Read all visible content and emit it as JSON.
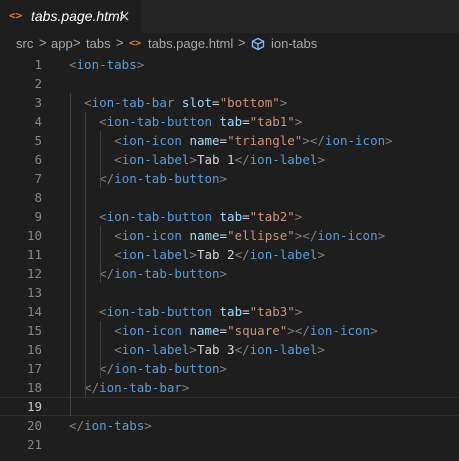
{
  "colors": {
    "background": "#1e1e1e",
    "tab_bar": "#252526",
    "file_icon": "#e37933",
    "tag": "#569cd6",
    "attribute": "#9cdcfe",
    "string": "#ce9178",
    "bracket": "#808080",
    "text": "#d4d4d4",
    "line_number": "#858585"
  },
  "tab": {
    "icon": "<>",
    "label": "tabs.page.html",
    "close": "×",
    "close_icon": "close-icon"
  },
  "breadcrumb": {
    "items": [
      "src",
      "app",
      "tabs",
      "tabs.page.html",
      "ion-tabs"
    ],
    "separator": ">",
    "file_icon": "<>",
    "symbol_icon": "cube-icon"
  },
  "editor": {
    "current_line": 19,
    "lines": [
      {
        "n": "1",
        "tokens": [
          [
            "b",
            "<"
          ],
          [
            "t",
            "ion-tabs"
          ],
          [
            "b",
            ">"
          ]
        ]
      },
      {
        "n": "2",
        "tokens": []
      },
      {
        "n": "3",
        "tokens": [
          [
            "s",
            "  "
          ],
          [
            "b",
            "<"
          ],
          [
            "t",
            "ion-tab-bar"
          ],
          [
            "s",
            " "
          ],
          [
            "a",
            "slot"
          ],
          [
            "e",
            "="
          ],
          [
            "r",
            "\"bottom\""
          ],
          [
            "b",
            ">"
          ]
        ]
      },
      {
        "n": "4",
        "tokens": [
          [
            "s",
            "    "
          ],
          [
            "b",
            "<"
          ],
          [
            "t",
            "ion-tab-button"
          ],
          [
            "s",
            " "
          ],
          [
            "a",
            "tab"
          ],
          [
            "e",
            "="
          ],
          [
            "r",
            "\"tab1\""
          ],
          [
            "b",
            ">"
          ]
        ]
      },
      {
        "n": "5",
        "tokens": [
          [
            "s",
            "      "
          ],
          [
            "b",
            "<"
          ],
          [
            "t",
            "ion-icon"
          ],
          [
            "s",
            " "
          ],
          [
            "a",
            "name"
          ],
          [
            "e",
            "="
          ],
          [
            "r",
            "\"triangle\""
          ],
          [
            "b",
            "></"
          ],
          [
            "t",
            "ion-icon"
          ],
          [
            "b",
            ">"
          ]
        ]
      },
      {
        "n": "6",
        "tokens": [
          [
            "s",
            "      "
          ],
          [
            "b",
            "<"
          ],
          [
            "t",
            "ion-label"
          ],
          [
            "b",
            ">"
          ],
          [
            "x",
            "Tab 1"
          ],
          [
            "b",
            "</"
          ],
          [
            "t",
            "ion-label"
          ],
          [
            "b",
            ">"
          ]
        ]
      },
      {
        "n": "7",
        "tokens": [
          [
            "s",
            "    "
          ],
          [
            "b",
            "</"
          ],
          [
            "t",
            "ion-tab-button"
          ],
          [
            "b",
            ">"
          ]
        ]
      },
      {
        "n": "8",
        "tokens": []
      },
      {
        "n": "9",
        "tokens": [
          [
            "s",
            "    "
          ],
          [
            "b",
            "<"
          ],
          [
            "t",
            "ion-tab-button"
          ],
          [
            "s",
            " "
          ],
          [
            "a",
            "tab"
          ],
          [
            "e",
            "="
          ],
          [
            "r",
            "\"tab2\""
          ],
          [
            "b",
            ">"
          ]
        ]
      },
      {
        "n": "10",
        "tokens": [
          [
            "s",
            "      "
          ],
          [
            "b",
            "<"
          ],
          [
            "t",
            "ion-icon"
          ],
          [
            "s",
            " "
          ],
          [
            "a",
            "name"
          ],
          [
            "e",
            "="
          ],
          [
            "r",
            "\"ellipse\""
          ],
          [
            "b",
            "></"
          ],
          [
            "t",
            "ion-icon"
          ],
          [
            "b",
            ">"
          ]
        ]
      },
      {
        "n": "11",
        "tokens": [
          [
            "s",
            "      "
          ],
          [
            "b",
            "<"
          ],
          [
            "t",
            "ion-label"
          ],
          [
            "b",
            ">"
          ],
          [
            "x",
            "Tab 2"
          ],
          [
            "b",
            "</"
          ],
          [
            "t",
            "ion-label"
          ],
          [
            "b",
            ">"
          ]
        ]
      },
      {
        "n": "12",
        "tokens": [
          [
            "s",
            "    "
          ],
          [
            "b",
            "</"
          ],
          [
            "t",
            "ion-tab-button"
          ],
          [
            "b",
            ">"
          ]
        ]
      },
      {
        "n": "13",
        "tokens": []
      },
      {
        "n": "14",
        "tokens": [
          [
            "s",
            "    "
          ],
          [
            "b",
            "<"
          ],
          [
            "t",
            "ion-tab-button"
          ],
          [
            "s",
            " "
          ],
          [
            "a",
            "tab"
          ],
          [
            "e",
            "="
          ],
          [
            "r",
            "\"tab3\""
          ],
          [
            "b",
            ">"
          ]
        ]
      },
      {
        "n": "15",
        "tokens": [
          [
            "s",
            "      "
          ],
          [
            "b",
            "<"
          ],
          [
            "t",
            "ion-icon"
          ],
          [
            "s",
            " "
          ],
          [
            "a",
            "name"
          ],
          [
            "e",
            "="
          ],
          [
            "r",
            "\"square\""
          ],
          [
            "b",
            "></"
          ],
          [
            "t",
            "ion-icon"
          ],
          [
            "b",
            ">"
          ]
        ]
      },
      {
        "n": "16",
        "tokens": [
          [
            "s",
            "      "
          ],
          [
            "b",
            "<"
          ],
          [
            "t",
            "ion-label"
          ],
          [
            "b",
            ">"
          ],
          [
            "x",
            "Tab 3"
          ],
          [
            "b",
            "</"
          ],
          [
            "t",
            "ion-label"
          ],
          [
            "b",
            ">"
          ]
        ]
      },
      {
        "n": "17",
        "tokens": [
          [
            "s",
            "    "
          ],
          [
            "b",
            "</"
          ],
          [
            "t",
            "ion-tab-button"
          ],
          [
            "b",
            ">"
          ]
        ]
      },
      {
        "n": "18",
        "tokens": [
          [
            "s",
            "  "
          ],
          [
            "b",
            "</"
          ],
          [
            "t",
            "ion-tab-bar"
          ],
          [
            "b",
            ">"
          ]
        ]
      },
      {
        "n": "19",
        "tokens": []
      },
      {
        "n": "20",
        "tokens": [
          [
            "b",
            "</"
          ],
          [
            "t",
            "ion-tabs"
          ],
          [
            "b",
            ">"
          ]
        ]
      },
      {
        "n": "21",
        "tokens": []
      }
    ]
  }
}
